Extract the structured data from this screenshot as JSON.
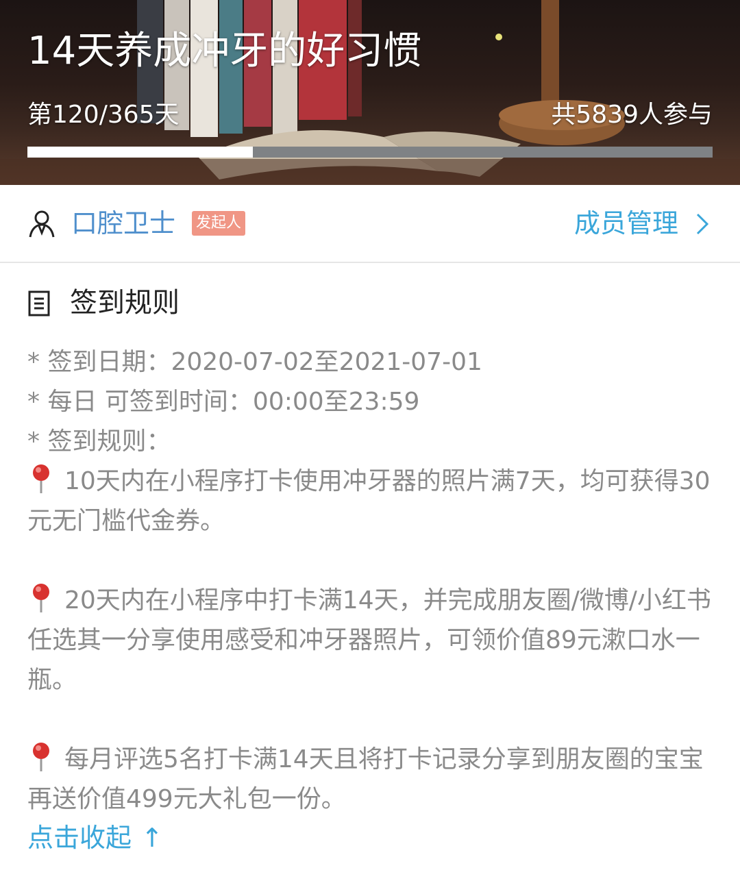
{
  "banner": {
    "title": "14天养成冲牙的好习惯",
    "day_progress": "第120/365天",
    "participants": "共5839人参与",
    "progress_fraction": 0.3288
  },
  "owner": {
    "name": "口腔卫士",
    "badge": "发起人",
    "member_management": "成员管理",
    "chevron": "›"
  },
  "rules": {
    "title": "签到规则",
    "date_range": "* 签到日期：2020-07-02至2021-07-01",
    "daily_time": "* 每日 可签到时间：00:00至23:59",
    "rule_heading": "* 签到规则：",
    "items": [
      "10天内在小程序打卡使用冲牙器的照片满7天，均可获得30元无门槛代金券。",
      "20天内在小程序中打卡满14天，并完成朋友圈/微博/小红书任选其一分享使用感受和冲牙器照片，可领价值89元漱口水一瓶。",
      "每月评选5名打卡满14天且将打卡记录分享到朋友圈的宝宝再送价值499元大礼包一份。"
    ],
    "collapse_label": "点击收起",
    "collapse_arrow": "↑"
  },
  "icons": {
    "person": "person-outline-icon",
    "document": "document-icon",
    "pin": "red-pushpin-icon",
    "chevron": "chevron-right-icon"
  },
  "colors": {
    "link_blue": "#3aa6da",
    "owner_blue": "#4f8fcc",
    "badge_bg": "#f09685",
    "rule_text": "#8a8a8a",
    "progress_track": "#7f8285",
    "progress_fill": "#ffffff"
  }
}
